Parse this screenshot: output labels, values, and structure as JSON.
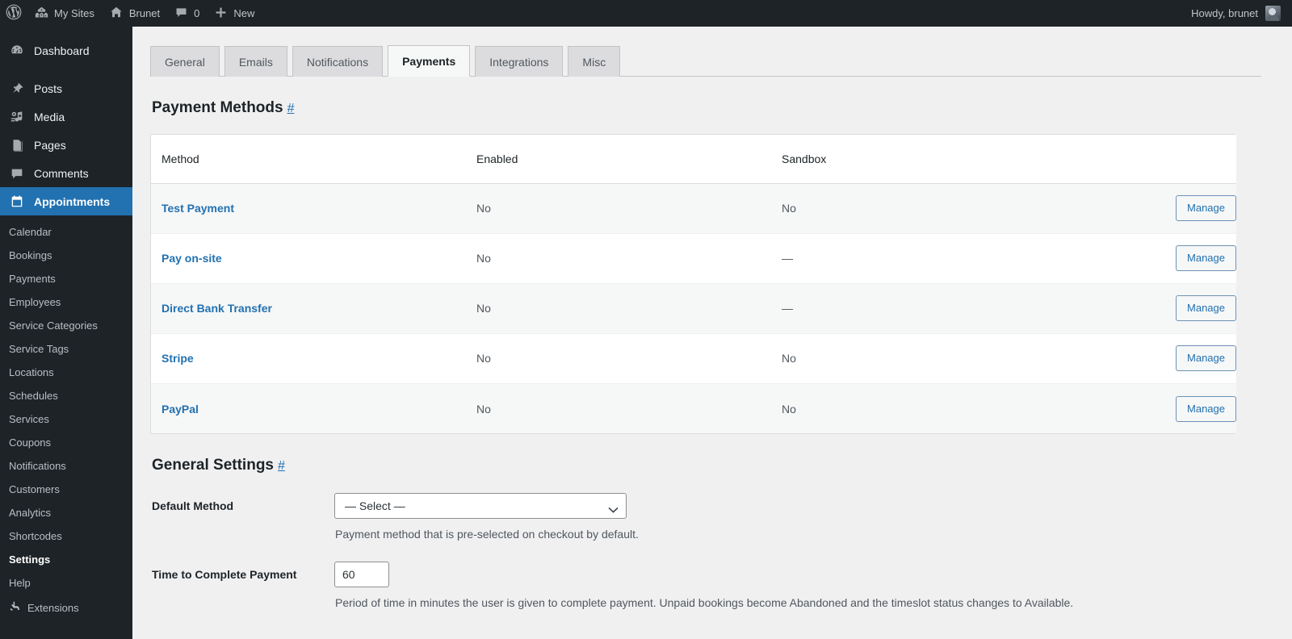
{
  "adminbar": {
    "wp_logo": "wordpress-logo",
    "items": [
      {
        "icon": "sites-icon",
        "label": "My Sites"
      },
      {
        "icon": "home-icon",
        "label": "Brunet"
      },
      {
        "icon": "comment-icon",
        "label": "0"
      },
      {
        "icon": "plus-icon",
        "label": "New"
      }
    ],
    "account": "Howdy, brunet"
  },
  "sidebar": {
    "top_items": [
      {
        "icon": "dashboard-icon",
        "label": "Dashboard",
        "current": false
      },
      {
        "icon": "posts-icon",
        "label": "Posts",
        "current": false
      },
      {
        "icon": "media-icon",
        "label": "Media",
        "current": false
      },
      {
        "icon": "pages-icon",
        "label": "Pages",
        "current": false
      },
      {
        "icon": "comments-icon",
        "label": "Comments",
        "current": false
      },
      {
        "icon": "calendar-icon",
        "label": "Appointments",
        "current": true
      }
    ],
    "submenu": [
      {
        "label": "Calendar",
        "active": false
      },
      {
        "label": "Bookings",
        "active": false
      },
      {
        "label": "Payments",
        "active": false
      },
      {
        "label": "Employees",
        "active": false
      },
      {
        "label": "Service Categories",
        "active": false
      },
      {
        "label": "Service Tags",
        "active": false
      },
      {
        "label": "Locations",
        "active": false
      },
      {
        "label": "Schedules",
        "active": false
      },
      {
        "label": "Services",
        "active": false
      },
      {
        "label": "Coupons",
        "active": false
      },
      {
        "label": "Notifications",
        "active": false
      },
      {
        "label": "Customers",
        "active": false
      },
      {
        "label": "Analytics",
        "active": false
      },
      {
        "label": "Shortcodes",
        "active": false
      },
      {
        "label": "Settings",
        "active": true
      },
      {
        "label": "Help",
        "active": false
      }
    ],
    "extensions": {
      "icon": "extensions-icon",
      "label": "Extensions"
    }
  },
  "tabs": [
    {
      "label": "General",
      "active": false
    },
    {
      "label": "Emails",
      "active": false
    },
    {
      "label": "Notifications",
      "active": false
    },
    {
      "label": "Payments",
      "active": true
    },
    {
      "label": "Integrations",
      "active": false
    },
    {
      "label": "Misc",
      "active": false
    }
  ],
  "payment_methods": {
    "heading": "Payment Methods",
    "anchor": "#",
    "columns": [
      "Method",
      "Enabled",
      "Sandbox",
      ""
    ],
    "rows": [
      {
        "method": "Test Payment",
        "enabled": "No",
        "sandbox": "No",
        "action": "Manage"
      },
      {
        "method": "Pay on-site",
        "enabled": "No",
        "sandbox": "—",
        "action": "Manage"
      },
      {
        "method": "Direct Bank Transfer",
        "enabled": "No",
        "sandbox": "—",
        "action": "Manage"
      },
      {
        "method": "Stripe",
        "enabled": "No",
        "sandbox": "No",
        "action": "Manage"
      },
      {
        "method": "PayPal",
        "enabled": "No",
        "sandbox": "No",
        "action": "Manage"
      }
    ]
  },
  "general_settings": {
    "heading": "General Settings",
    "anchor": "#",
    "default_method": {
      "label": "Default Method",
      "value": "— Select —",
      "help": "Payment method that is pre-selected on checkout by default."
    },
    "time_to_complete": {
      "label": "Time to Complete Payment",
      "value": "60",
      "help": "Period of time in minutes the user is given to complete payment. Unpaid bookings become Abandoned and the timeslot status changes to Available."
    }
  },
  "colors": {
    "adminbar_bg": "#1d2327",
    "sidebar_bg": "#1d2327",
    "current_menu": "#2271b1",
    "link_blue": "#2271b1",
    "content_bg": "#f0f0f1"
  }
}
